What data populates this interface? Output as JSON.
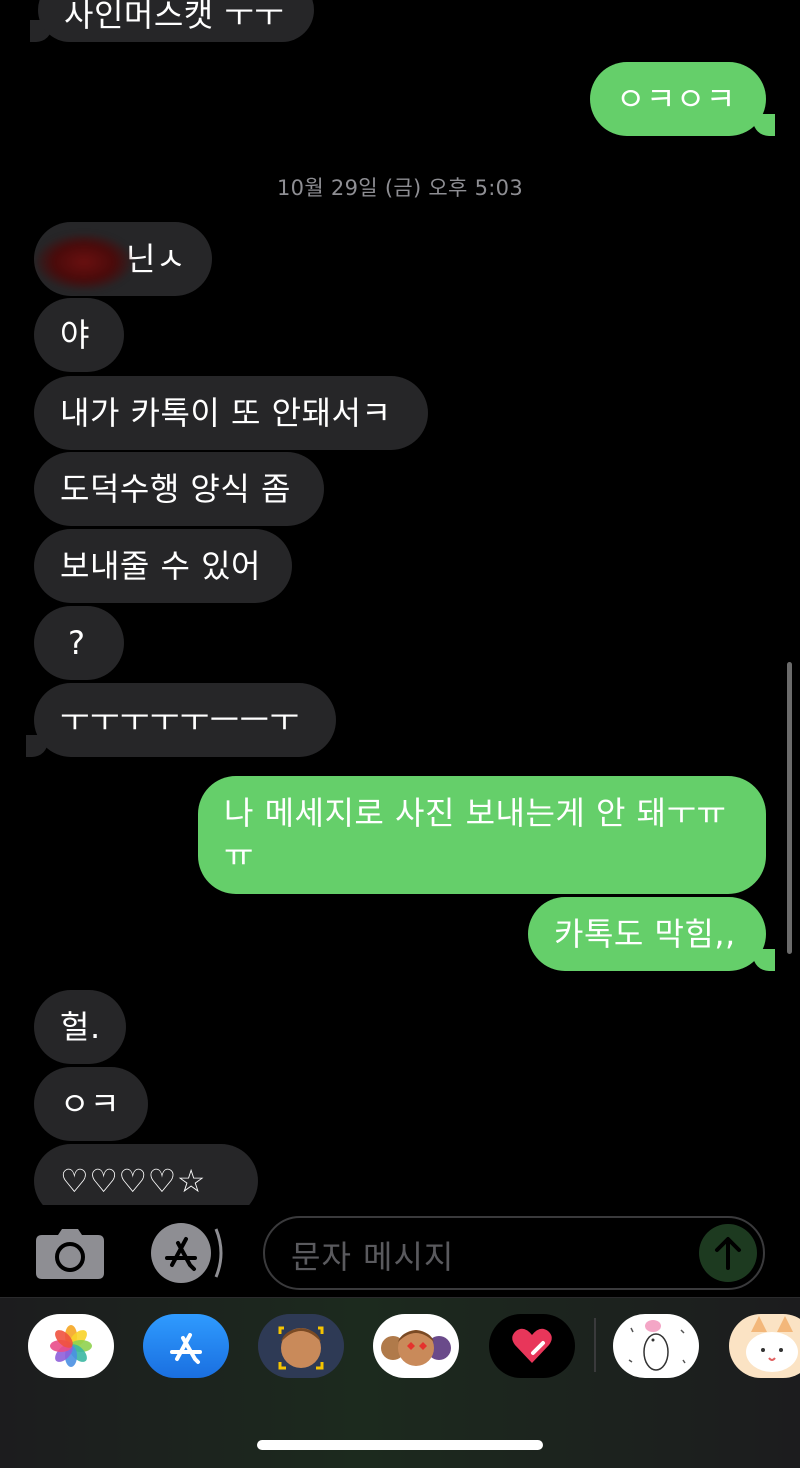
{
  "messages": [
    {
      "id": "m0",
      "text": "사인머스캣 ㅜㅜ",
      "dir": "in"
    },
    {
      "id": "m1",
      "text": "ㅇㅋㅇㅋ",
      "dir": "out"
    },
    {
      "id": "m2",
      "text": "닌ㅅ",
      "dir": "in"
    },
    {
      "id": "m3",
      "text": "야",
      "dir": "in"
    },
    {
      "id": "m4",
      "text": "내가 카톡이 또 안돼서ㅋ",
      "dir": "in"
    },
    {
      "id": "m5",
      "text": "도덕수행 양식 좀",
      "dir": "in"
    },
    {
      "id": "m6",
      "text": "보내줄 수 있어",
      "dir": "in"
    },
    {
      "id": "m7",
      "text": "?",
      "dir": "in"
    },
    {
      "id": "m8",
      "text": "ㅜㅜㅜㅜㅜㅡㅡㅜ",
      "dir": "in"
    },
    {
      "id": "m9",
      "text": "나 메세지로 사진 보내는게 안 돼ㅜㅠ\nㅠ",
      "dir": "out"
    },
    {
      "id": "m10",
      "text": "카톡도 막힘,,",
      "dir": "out"
    },
    {
      "id": "m11",
      "text": "헐.",
      "dir": "in"
    },
    {
      "id": "m12",
      "text": "ㅇㅋ",
      "dir": "in"
    },
    {
      "id": "m13",
      "text": "♡♡♡♡☆",
      "dir": "in"
    }
  ],
  "timestamp": "10월 29일 (금) 오후 5:03",
  "input": {
    "placeholder": "문자 메시지"
  },
  "icons": {
    "camera": "camera-icon",
    "appstore": "appstore-icon",
    "send": "send-arrow-icon"
  },
  "apps": [
    "photos",
    "app-store",
    "memoji-camera",
    "memoji-stickers",
    "digital-touch",
    "sticker-bunny",
    "sticker-fox"
  ],
  "colors": {
    "outgoing": "#65cf6a",
    "incoming": "#262628",
    "background": "#000000"
  }
}
